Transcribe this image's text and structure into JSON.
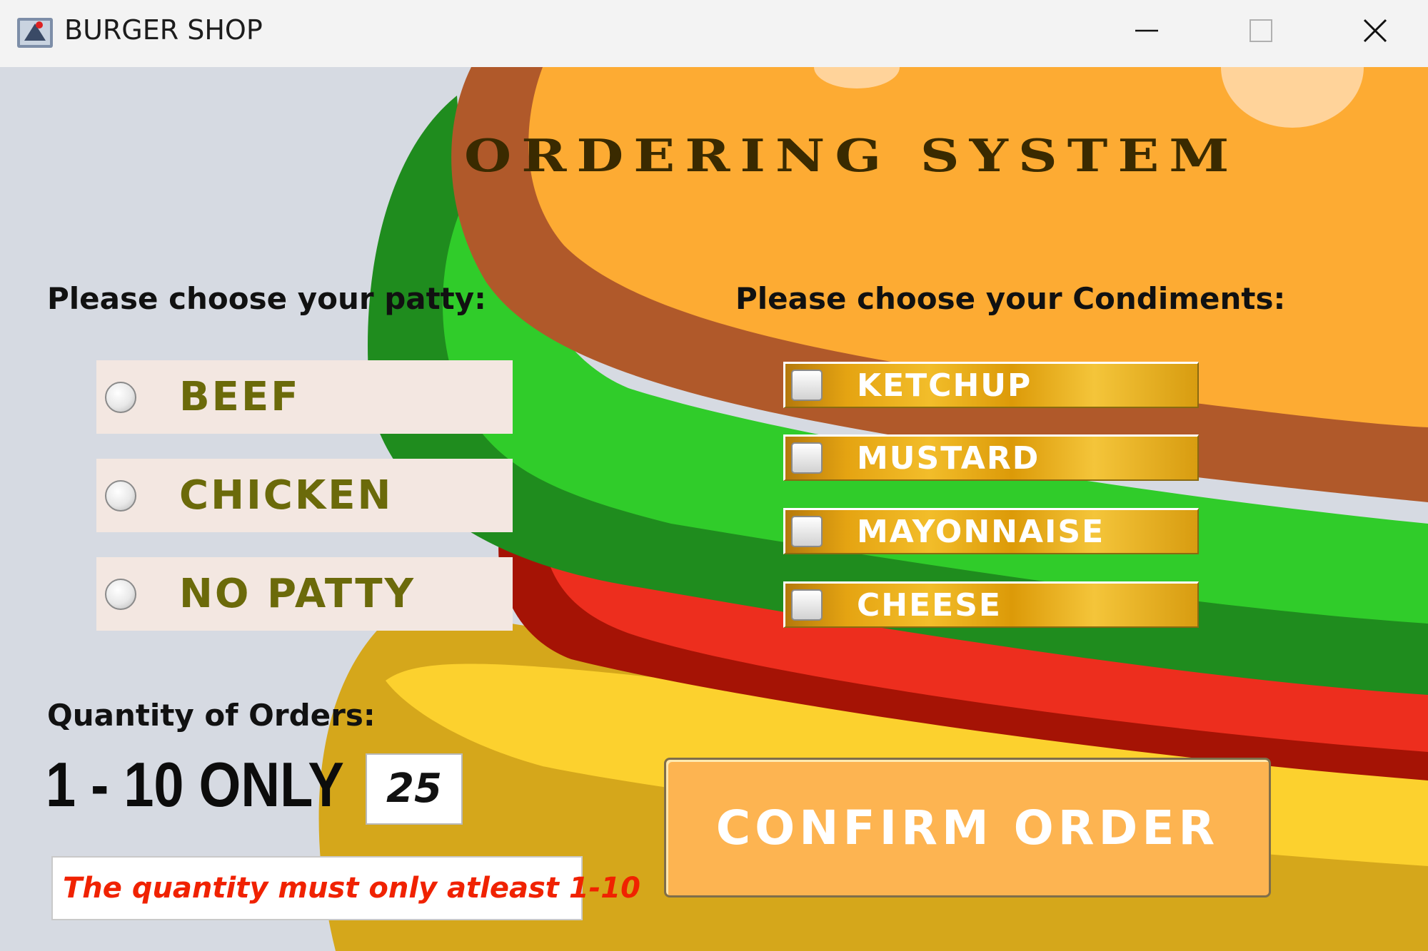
{
  "window": {
    "title": "BURGER SHOP",
    "controls": {
      "minimize": "minimize-icon",
      "maximize": "maximize-icon",
      "close": "close-icon"
    }
  },
  "main": {
    "heading": "ORDERING SYSTEM",
    "patty": {
      "label": "Please choose your patty:",
      "options": [
        "BEEF",
        "CHICKEN",
        "NO PATTY"
      ]
    },
    "condiments": {
      "label": "Please choose your Condiments:",
      "options": [
        "KETCHUP",
        "MUSTARD",
        "MAYONNAISE",
        "CHEESE"
      ]
    },
    "quantity": {
      "label": "Quantity of Orders:",
      "range_label": "1 - 10 ONLY",
      "value": "25",
      "error": "The quantity must only atleast 1-10"
    },
    "confirm_label": "CONFIRM ORDER"
  },
  "colors": {
    "background": "#d6dae2",
    "bun": "#fdab33",
    "bun_edge": "#b0592a",
    "lettuce": "#30cc2a",
    "tomato": "#ed2e1e",
    "cheese": "#fcd12e",
    "error_text": "#f02200",
    "option_text": "#6b6a0a"
  }
}
